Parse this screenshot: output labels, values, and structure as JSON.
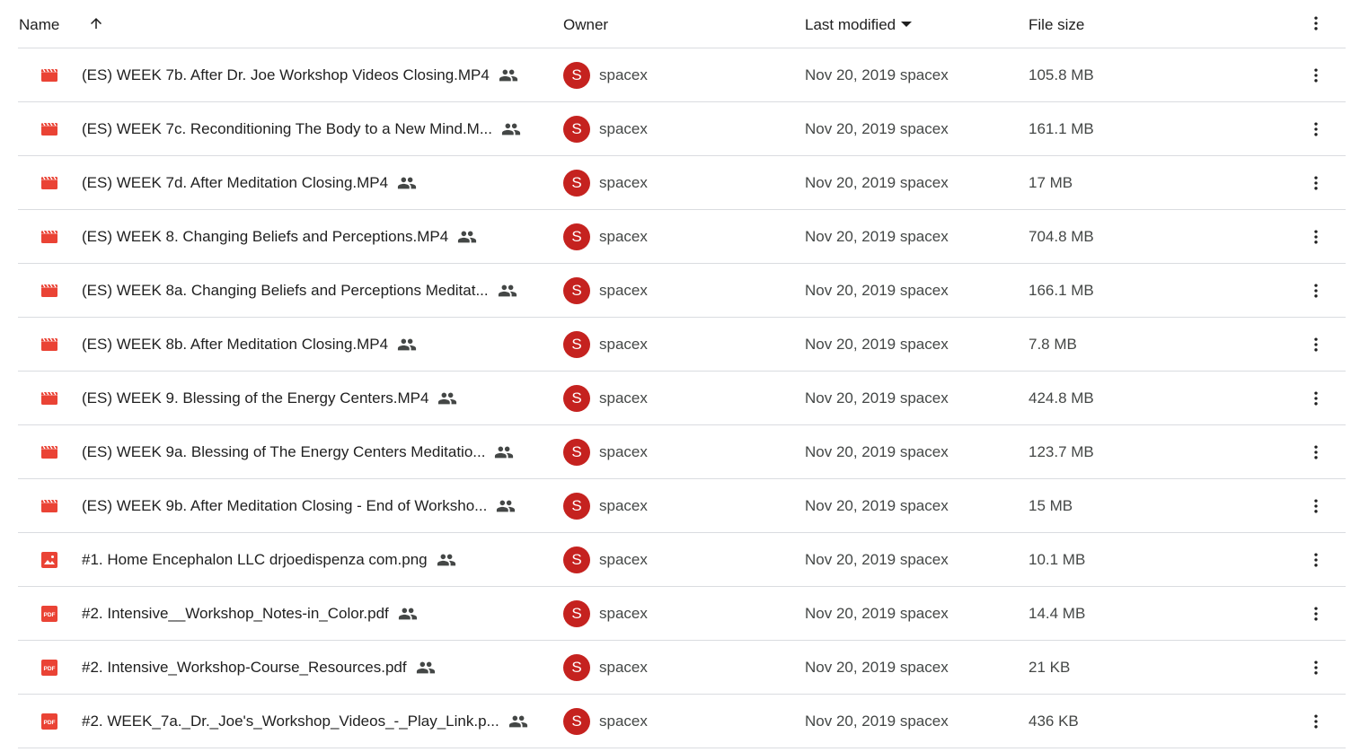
{
  "header": {
    "name_label": "Name",
    "sort_icon": "arrow-up-icon",
    "owner_label": "Owner",
    "modified_label": "Last modified",
    "size_label": "File size",
    "more_icon": "more-vert-icon"
  },
  "colors": {
    "video_icon": "#ea4335",
    "avatar_bg": "#c5221f",
    "divider": "#dadce0"
  },
  "files": [
    {
      "type": "video",
      "name": "(ES) WEEK 7b. After Dr. Joe Workshop Videos Closing.MP4",
      "owner_initial": "S",
      "owner": "spacex",
      "modified": "Nov 20, 2019 spacex",
      "size": "105.8 MB"
    },
    {
      "type": "video",
      "name": "(ES) WEEK 7c. Reconditioning The Body to a New Mind.M...",
      "owner_initial": "S",
      "owner": "spacex",
      "modified": "Nov 20, 2019 spacex",
      "size": "161.1 MB"
    },
    {
      "type": "video",
      "name": "(ES) WEEK 7d. After Meditation Closing.MP4",
      "owner_initial": "S",
      "owner": "spacex",
      "modified": "Nov 20, 2019 spacex",
      "size": "17 MB"
    },
    {
      "type": "video",
      "name": "(ES) WEEK 8. Changing Beliefs and Perceptions.MP4",
      "owner_initial": "S",
      "owner": "spacex",
      "modified": "Nov 20, 2019 spacex",
      "size": "704.8 MB"
    },
    {
      "type": "video",
      "name": "(ES) WEEK 8a. Changing Beliefs and Perceptions Meditat...",
      "owner_initial": "S",
      "owner": "spacex",
      "modified": "Nov 20, 2019 spacex",
      "size": "166.1 MB"
    },
    {
      "type": "video",
      "name": "(ES) WEEK 8b. After Meditation Closing.MP4",
      "owner_initial": "S",
      "owner": "spacex",
      "modified": "Nov 20, 2019 spacex",
      "size": "7.8 MB"
    },
    {
      "type": "video",
      "name": "(ES) WEEK 9. Blessing of the Energy Centers.MP4",
      "owner_initial": "S",
      "owner": "spacex",
      "modified": "Nov 20, 2019 spacex",
      "size": "424.8 MB"
    },
    {
      "type": "video",
      "name": "(ES) WEEK 9a. Blessing of The Energy Centers Meditatio...",
      "owner_initial": "S",
      "owner": "spacex",
      "modified": "Nov 20, 2019 spacex",
      "size": "123.7 MB"
    },
    {
      "type": "video",
      "name": "(ES) WEEK 9b. After Meditation Closing - End of Worksho...",
      "owner_initial": "S",
      "owner": "spacex",
      "modified": "Nov 20, 2019 spacex",
      "size": "15 MB"
    },
    {
      "type": "image",
      "name": "#1. Home Encephalon  LLC  drjoedispenza com.png",
      "owner_initial": "S",
      "owner": "spacex",
      "modified": "Nov 20, 2019 spacex",
      "size": "10.1 MB"
    },
    {
      "type": "pdf",
      "name": "#2. Intensive__Workshop_Notes-in_Color.pdf",
      "owner_initial": "S",
      "owner": "spacex",
      "modified": "Nov 20, 2019 spacex",
      "size": "14.4 MB"
    },
    {
      "type": "pdf",
      "name": "#2. Intensive_Workshop-Course_Resources.pdf",
      "owner_initial": "S",
      "owner": "spacex",
      "modified": "Nov 20, 2019 spacex",
      "size": "21 KB"
    },
    {
      "type": "pdf",
      "name": "#2. WEEK_7a._Dr._Joe's_Workshop_Videos_-_Play_Link.p...",
      "owner_initial": "S",
      "owner": "spacex",
      "modified": "Nov 20, 2019 spacex",
      "size": "436 KB"
    }
  ]
}
